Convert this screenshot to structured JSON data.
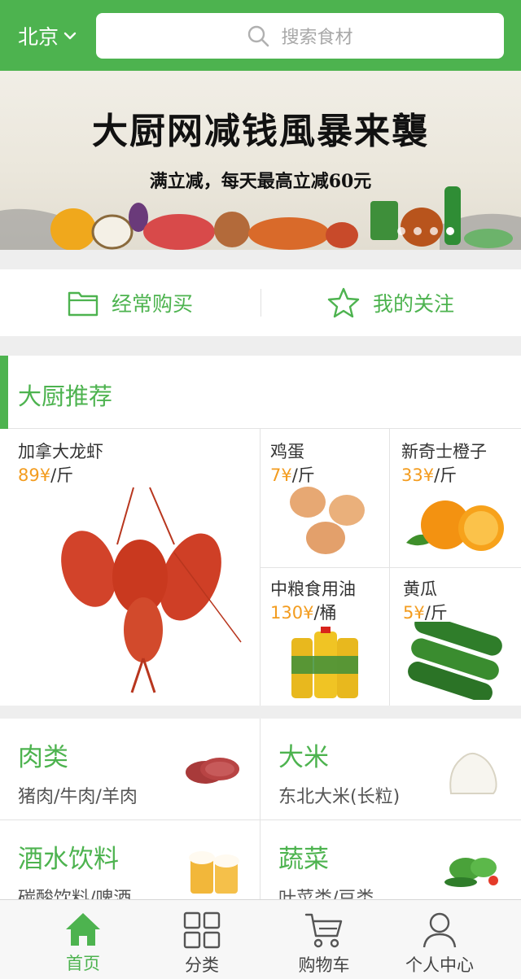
{
  "header": {
    "city": "北京",
    "search_placeholder": "搜索食材"
  },
  "banner": {
    "title": "大厨网减钱風暴来襲",
    "subtitle": "满立减，每天最高立减60元",
    "slide_count": 4,
    "active_slide": 4
  },
  "quick_links": [
    {
      "label": "经常购买",
      "icon": "folder-icon"
    },
    {
      "label": "我的关注",
      "icon": "star-icon"
    }
  ],
  "recommend": {
    "title": "大厨推荐",
    "items": [
      {
        "name": "加拿大龙虾",
        "price": "89¥",
        "unit": "/斤"
      },
      {
        "name": "鸡蛋",
        "price": "7¥",
        "unit": "/斤"
      },
      {
        "name": "新奇士橙子",
        "price": "33¥",
        "unit": "/斤"
      },
      {
        "name": "中粮食用油",
        "price": "130¥",
        "unit": "/桶"
      },
      {
        "name": "黄瓜",
        "price": "5¥",
        "unit": "/斤"
      }
    ]
  },
  "categories": [
    {
      "name": "肉类",
      "sub": "猪肉/牛肉/羊肉"
    },
    {
      "name": "大米",
      "sub": "东北大米(长粒)"
    },
    {
      "name": "酒水饮料",
      "sub": "碳酸饮料/啤酒"
    },
    {
      "name": "蔬菜",
      "sub": "叶菜类/豆类"
    }
  ],
  "tabbar": [
    {
      "label": "首页",
      "icon": "home-icon",
      "active": true
    },
    {
      "label": "分类",
      "icon": "grid-icon",
      "active": false
    },
    {
      "label": "购物车",
      "icon": "cart-icon",
      "active": false
    },
    {
      "label": "个人中心",
      "icon": "user-icon",
      "active": false
    }
  ],
  "colors": {
    "brand": "#4db34f",
    "price": "#f39c1f"
  }
}
